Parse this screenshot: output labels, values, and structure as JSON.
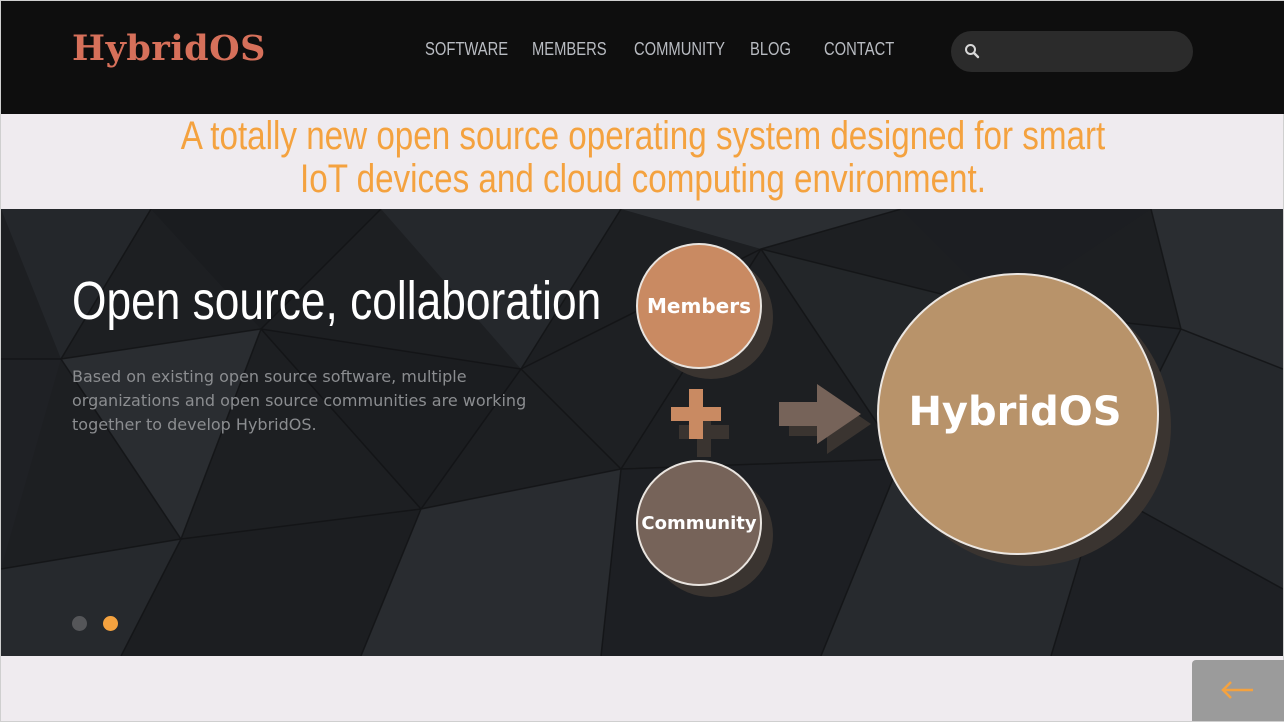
{
  "header": {
    "logo": "HybridOS",
    "nav": [
      {
        "label": "SOFTWARE"
      },
      {
        "label": "MEMBERS"
      },
      {
        "label": "COMMUNITY"
      },
      {
        "label": "BLOG"
      },
      {
        "label": "CONTACT"
      }
    ],
    "search": {
      "value": "",
      "placeholder": "",
      "icon": "search-icon"
    }
  },
  "tagline": "A totally new open source operating system designed for smart IoT devices and cloud computing environment.",
  "hero": {
    "title": "Open source, collaboration",
    "description": "Based on existing open source software, multiple organizations and open source communities are working together to develop HybridOS.",
    "diagram": {
      "members": "Members",
      "community": "Community",
      "result": "HybridOS"
    },
    "slides": {
      "count": 2,
      "active_index": 1
    }
  },
  "back_to_top": {
    "icon": "arrow-left-icon"
  },
  "colors": {
    "accent": "#f4a23f",
    "logo": "#d6705a",
    "header_bg": "#0e0e0e",
    "hero_bg": "#1d1f22",
    "members_circle": "#c98a62",
    "community_circle": "#766359",
    "hybridos_circle": "#b8936a"
  }
}
